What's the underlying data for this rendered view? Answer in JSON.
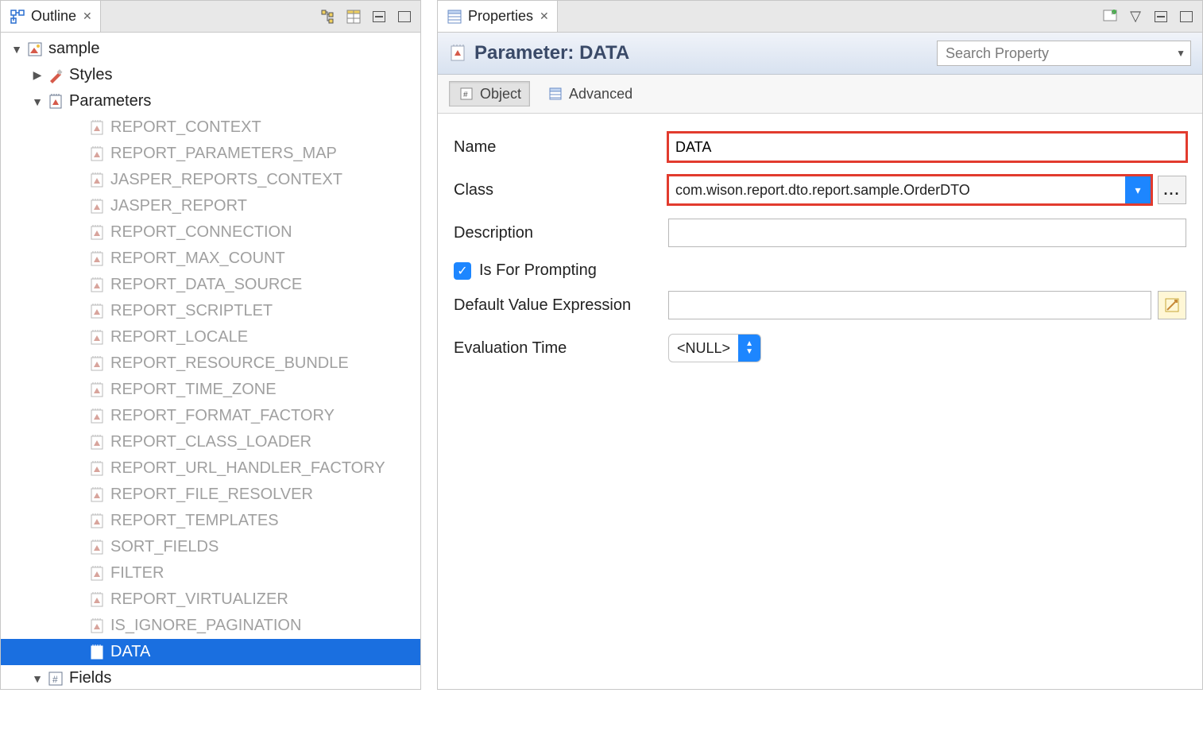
{
  "outline": {
    "tab_label": "Outline",
    "root": {
      "label": "sample",
      "children": [
        {
          "label": "Styles",
          "expandable": true,
          "expanded": false,
          "icon": "styles"
        },
        {
          "label": "Parameters",
          "expandable": true,
          "expanded": true,
          "icon": "param",
          "children": [
            {
              "label": "REPORT_CONTEXT",
              "dim": true
            },
            {
              "label": "REPORT_PARAMETERS_MAP",
              "dim": true
            },
            {
              "label": "JASPER_REPORTS_CONTEXT",
              "dim": true
            },
            {
              "label": "JASPER_REPORT",
              "dim": true
            },
            {
              "label": "REPORT_CONNECTION",
              "dim": true
            },
            {
              "label": "REPORT_MAX_COUNT",
              "dim": true
            },
            {
              "label": "REPORT_DATA_SOURCE",
              "dim": true
            },
            {
              "label": "REPORT_SCRIPTLET",
              "dim": true
            },
            {
              "label": "REPORT_LOCALE",
              "dim": true
            },
            {
              "label": "REPORT_RESOURCE_BUNDLE",
              "dim": true
            },
            {
              "label": "REPORT_TIME_ZONE",
              "dim": true
            },
            {
              "label": "REPORT_FORMAT_FACTORY",
              "dim": true
            },
            {
              "label": "REPORT_CLASS_LOADER",
              "dim": true
            },
            {
              "label": "REPORT_URL_HANDLER_FACTORY",
              "dim": true
            },
            {
              "label": "REPORT_FILE_RESOLVER",
              "dim": true
            },
            {
              "label": "REPORT_TEMPLATES",
              "dim": true
            },
            {
              "label": "SORT_FIELDS",
              "dim": true
            },
            {
              "label": "FILTER",
              "dim": true
            },
            {
              "label": "REPORT_VIRTUALIZER",
              "dim": true
            },
            {
              "label": "IS_IGNORE_PAGINATION",
              "dim": true
            },
            {
              "label": "DATA",
              "selected": true
            }
          ]
        },
        {
          "label": "Fields",
          "expandable": true,
          "expanded": true,
          "icon": "field",
          "cut": true
        }
      ]
    }
  },
  "properties": {
    "tab_label": "Properties",
    "title_prefix": "Parameter: ",
    "title_name": "DATA",
    "search_placeholder": "Search Property",
    "subtabs": {
      "object": "Object",
      "advanced": "Advanced"
    },
    "fields": {
      "name_label": "Name",
      "name_value": "DATA",
      "class_label": "Class",
      "class_value": "com.wison.report.dto.report.sample.OrderDTO",
      "description_label": "Description",
      "description_value": "",
      "prompting_label": "Is For Prompting",
      "prompting_checked": true,
      "default_expr_label": "Default Value Expression",
      "default_expr_value": "",
      "eval_time_label": "Evaluation Time",
      "eval_time_value": "<NULL>"
    }
  }
}
